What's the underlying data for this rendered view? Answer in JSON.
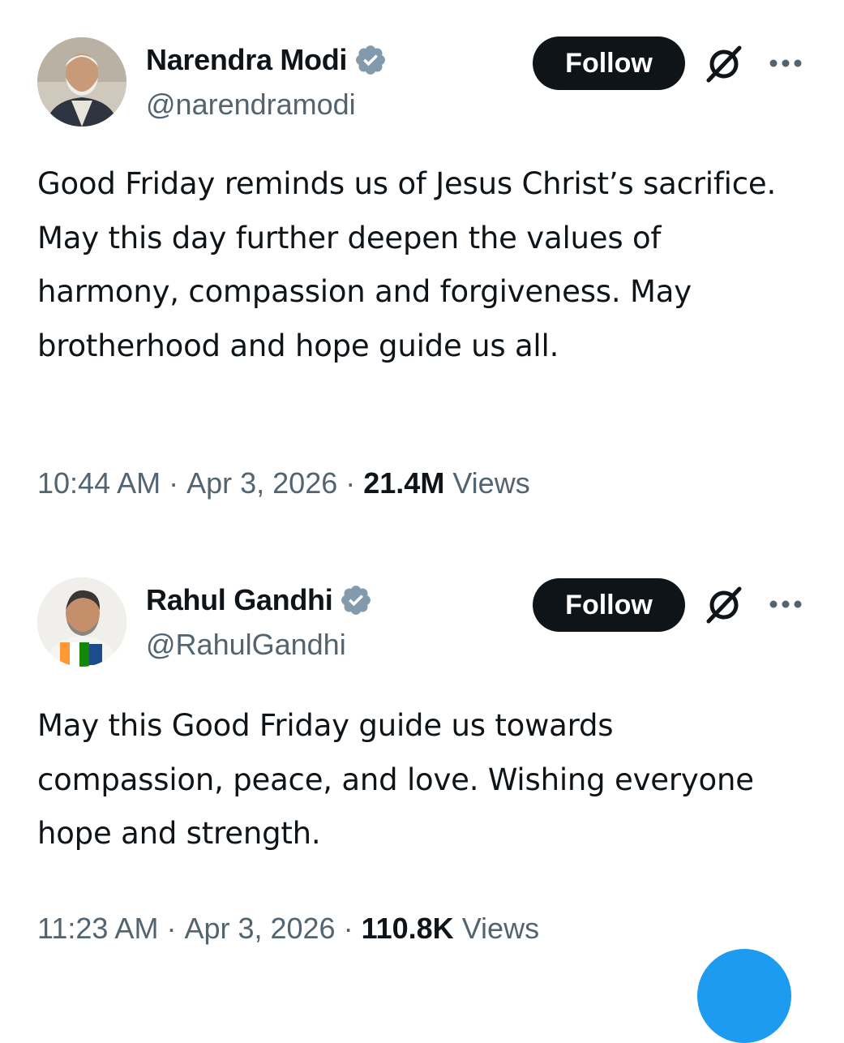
{
  "tweets": [
    {
      "display_name": "Narendra Modi",
      "handle": "@narendramodi",
      "verified": true,
      "follow_label": "Follow",
      "text": "Good Friday reminds us of Jesus Christ’s sacrifice. May this day further deepen the values of harmony, compassion and forgiveness. May brotherhood and hope guide us all.",
      "time": "10:44 AM",
      "separator": "·",
      "date": "Apr 3, 2026",
      "views_count": "21.4M",
      "views_label": "Views"
    },
    {
      "display_name": "Rahul Gandhi",
      "handle": "@RahulGandhi",
      "verified": true,
      "follow_label": "Follow",
      "text": "May this Good Friday guide us towards compassion, peace, and love. Wishing everyone hope and strength.",
      "time": "11:23 AM",
      "separator": "·",
      "date": "Apr 3, 2026",
      "views_count": "110.8K",
      "views_label": "Views"
    }
  ],
  "icons": {
    "verified": "verified-badge-icon",
    "grok": "grok-icon",
    "more": "more-options-icon"
  },
  "colors": {
    "text_primary": "#0f1419",
    "text_secondary": "#536471",
    "follow_button_bg": "#0f1419",
    "follow_button_text": "#ffffff",
    "verified_badge": "#829aab",
    "accent": "#1d9bf0"
  }
}
